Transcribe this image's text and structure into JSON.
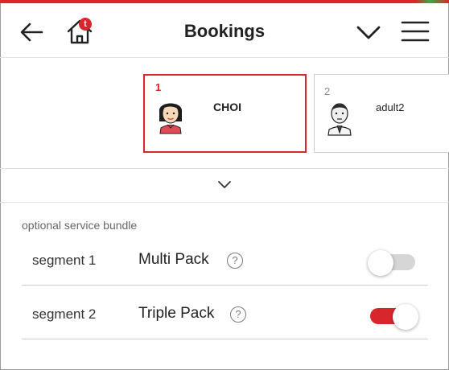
{
  "header": {
    "title": "Bookings",
    "home_badge": "t",
    "icons": {
      "back": "arrow-left-icon",
      "home": "home-icon",
      "chevron": "chevron-down-icon",
      "menu": "hamburger-menu-icon"
    }
  },
  "passengers": [
    {
      "number": "1",
      "name": "CHOI",
      "avatar": "female-avatar-icon",
      "selected": true
    },
    {
      "number": "2",
      "name": "adult2",
      "avatar": "male-avatar-icon",
      "selected": false
    }
  ],
  "bundle": {
    "section_label": "optional service bundle",
    "rows": [
      {
        "segment": "segment 1",
        "pack": "Multi Pack",
        "help": "?",
        "enabled": false
      },
      {
        "segment": "segment 2",
        "pack": "Triple Pack",
        "help": "?",
        "enabled": true
      }
    ]
  },
  "colors": {
    "accent": "#d9262c",
    "toggle_off": "#d6d6d6",
    "divider": "#e2e2e2"
  }
}
